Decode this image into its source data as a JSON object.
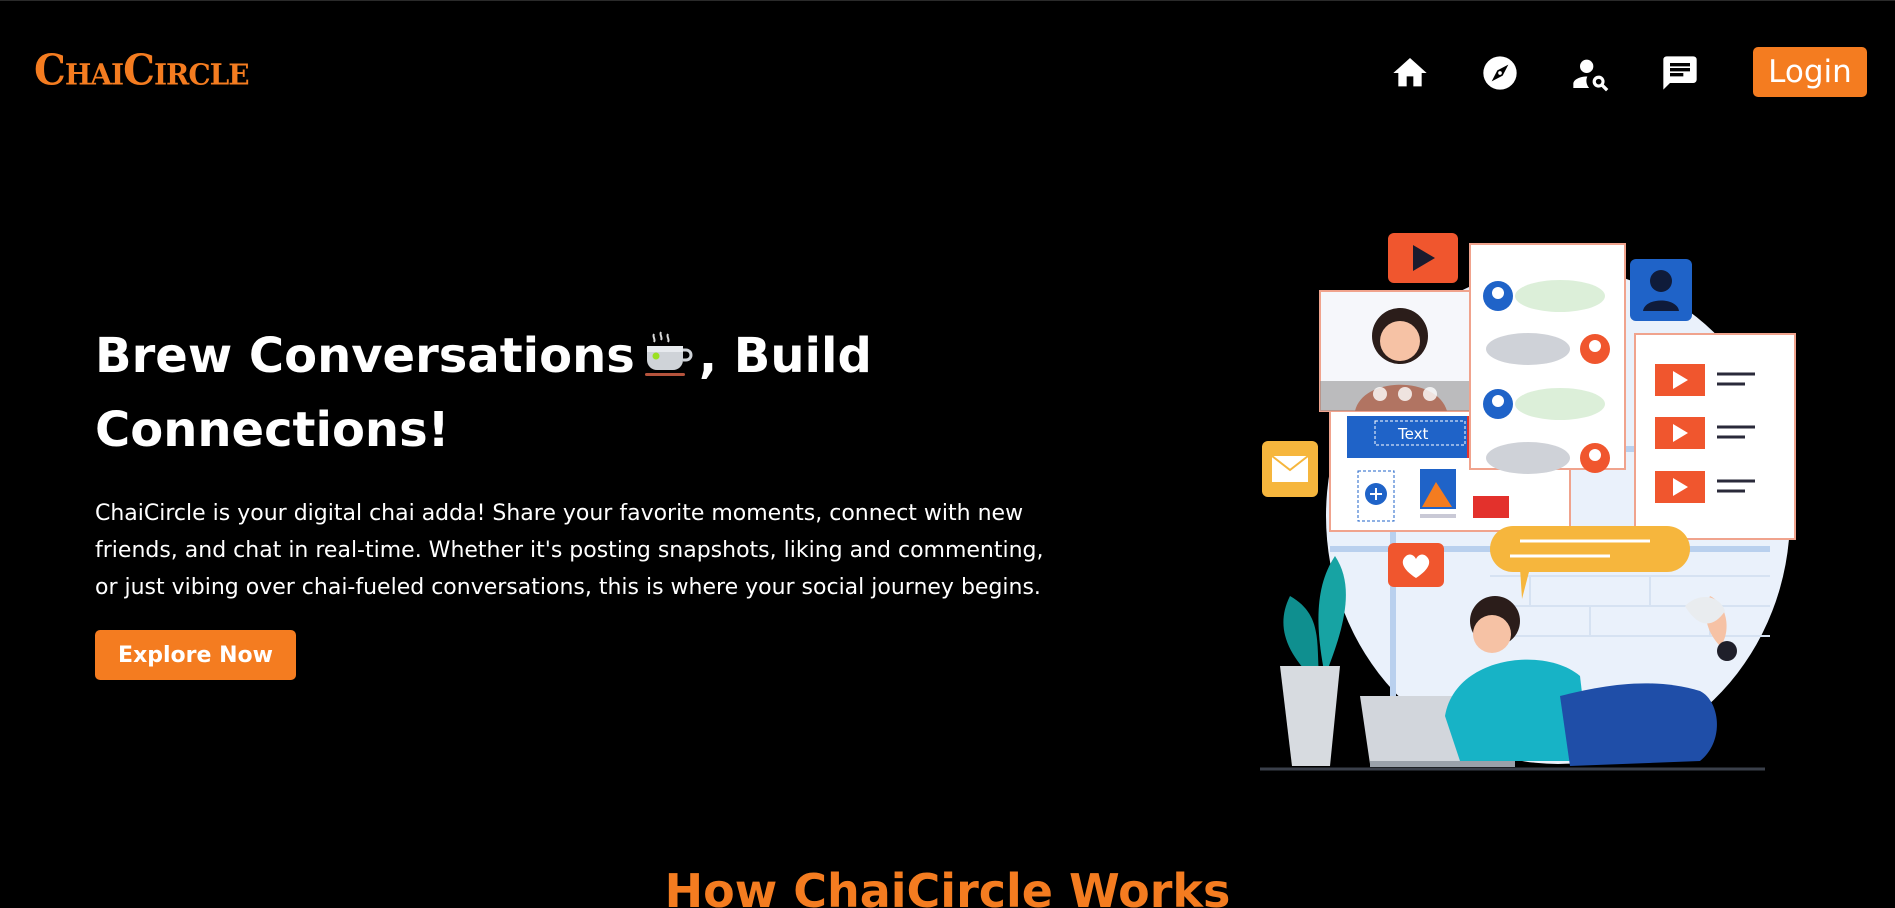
{
  "navbar": {
    "brand": "ChaiCircle",
    "icons": [
      {
        "name": "home-icon"
      },
      {
        "name": "compass-icon"
      },
      {
        "name": "user-search-icon"
      },
      {
        "name": "chat-icon"
      }
    ],
    "login_label": "Login"
  },
  "hero": {
    "title_part1": "Brew Conversations",
    "title_emoji": "tea-cup-icon",
    "title_part2": ", Build",
    "title_line2": "Connections!",
    "description": "ChaiCircle is your digital chai adda! Share your favorite moments, connect with new friends, and chat in real-time. Whether it's posting snapshots, liking and commenting, or just vibing over chai-fueled conversations, this is where your social journey begins.",
    "cta_label": "Explore Now",
    "illustration": {
      "text_label": "Text"
    }
  },
  "section": {
    "title": "How ChaiCircle Works"
  },
  "colors": {
    "accent": "#f47c20",
    "background": "#000000",
    "text": "#ffffff"
  }
}
